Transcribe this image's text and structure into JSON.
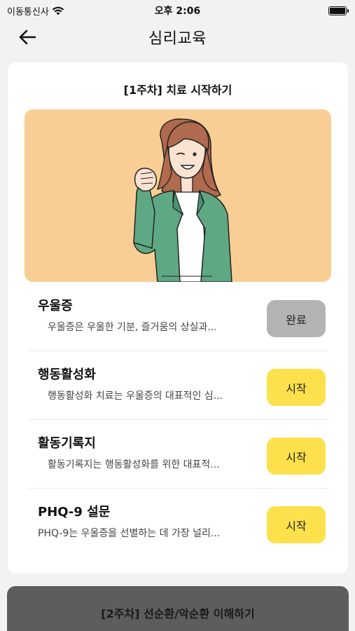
{
  "status_bar": {
    "carrier": "이동통신사",
    "time": "오후 2:06",
    "wifi_icon": "wifi-icon",
    "battery_icon": "battery-icon"
  },
  "nav": {
    "back_icon": "arrow-left-icon",
    "title": "심리교육"
  },
  "week1": {
    "title": "[1주차] 치료 시작하기",
    "hero_image": "woman-fist-pump-illustration",
    "colors": {
      "hero_bg": "#f9ce94",
      "done_button": "#b3b3b3",
      "start_button": "#fde14c"
    },
    "items": [
      {
        "title": "우울증",
        "desc": "우울증은 우울한 기분, 즐거움의 상실과...",
        "button": "완료",
        "state": "done"
      },
      {
        "title": "행동활성화",
        "desc": "행동활성화 치료는 우울증의 대표적인 심...",
        "button": "시작",
        "state": "start"
      },
      {
        "title": "활동기록지",
        "desc": "활동기록지는 행동활성화를 위한 대표적...",
        "button": "시작",
        "state": "start"
      },
      {
        "title": "PHQ-9 설문",
        "desc": "PHQ-9는 우울증을 선별하는 데 가장 널리...",
        "button": "시작",
        "state": "start"
      }
    ]
  },
  "week2": {
    "title": "[2주차] 선순환/악순환 이해하기",
    "color": "#5d5d5d"
  }
}
